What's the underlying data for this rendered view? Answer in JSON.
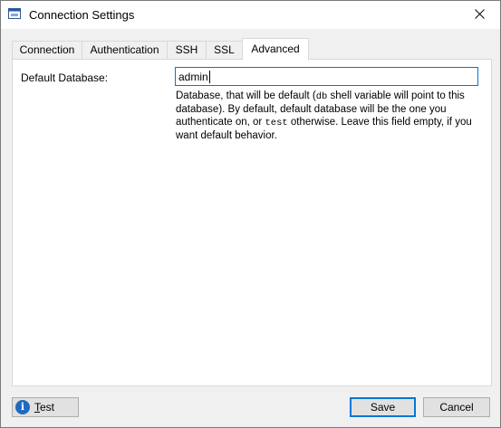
{
  "window": {
    "title": "Connection Settings",
    "close_glyph": "✕",
    "icon": "window-icon"
  },
  "tabs": [
    {
      "label": "Connection"
    },
    {
      "label": "Authentication"
    },
    {
      "label": "SSH"
    },
    {
      "label": "SSL"
    },
    {
      "label": "Advanced",
      "active": true
    }
  ],
  "advanced": {
    "default_db_label": "Default Database:",
    "default_db_value": "admin",
    "help_part1": "Database, that will be default (",
    "help_code1": "db",
    "help_part2": " shell variable will point to this database). By default, default database will be the one you authenticate on, or ",
    "help_code2": "test",
    "help_part3": " otherwise. Leave this field empty, if you want default behavior."
  },
  "footer": {
    "test_label_underlined": "T",
    "test_label_rest": "est",
    "save_label": "Save",
    "cancel_label": "Cancel",
    "info_glyph": "i"
  },
  "colors": {
    "accent": "#0078d7",
    "info_icon": "#1e6bbf"
  }
}
